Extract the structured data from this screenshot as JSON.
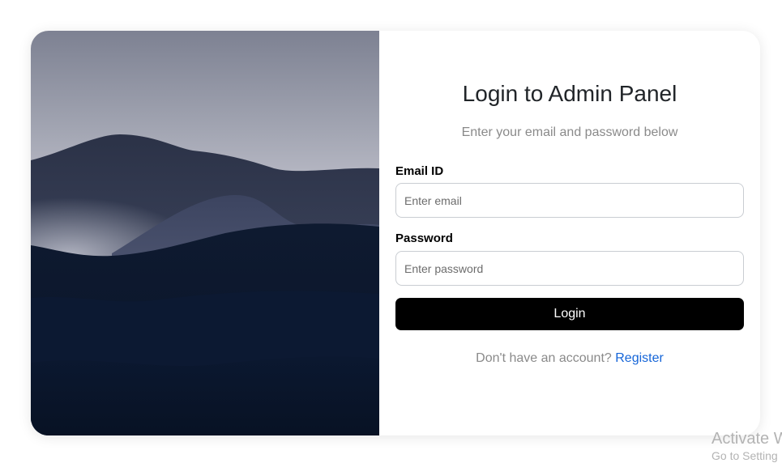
{
  "login": {
    "title": "Login to Admin Panel",
    "subtitle": "Enter your email and password below",
    "email_label": "Email ID",
    "email_placeholder": "Enter email",
    "email_value": "",
    "password_label": "Password",
    "password_placeholder": "Enter password",
    "password_value": "",
    "button_label": "Login",
    "footer_text": "Don't have an account?",
    "register_link": "Register"
  },
  "hero": {
    "icon": "mountain-landscape-image"
  },
  "watermark": {
    "line1": "Activate W",
    "line2": "Go to Setting"
  },
  "colors": {
    "button_bg": "#000000",
    "link": "#1565d8",
    "muted_text": "#8a8a8a"
  }
}
